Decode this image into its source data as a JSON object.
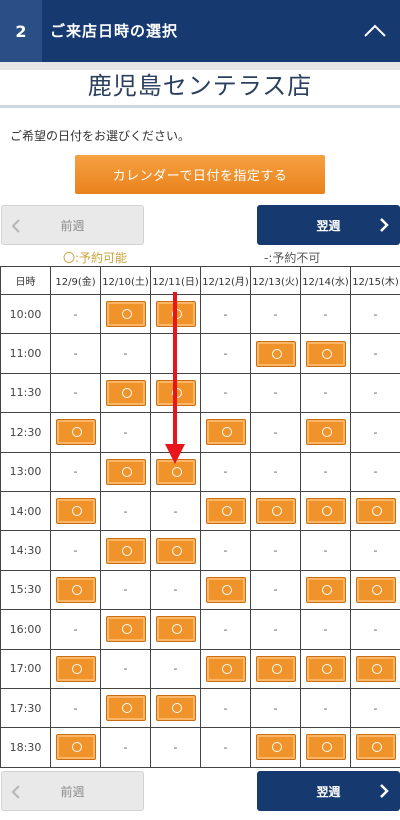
{
  "header": {
    "step_number": "2",
    "title": "ご来店日時の選択"
  },
  "store": {
    "name": "鹿児島センテラス店"
  },
  "instruction": "ご希望の日付をお選びください。",
  "calendar_button": "カレンダーで日付を指定する",
  "nav": {
    "prev_label": "前週",
    "next_label": "翌週"
  },
  "legend": {
    "available": "〇:予約可能",
    "unavailable": "-:予約不可"
  },
  "schedule": {
    "time_header": "日時",
    "dates": [
      {
        "label": "12/9(金)",
        "type": "weekday"
      },
      {
        "label": "12/10(土)",
        "type": "sat"
      },
      {
        "label": "12/11(日)",
        "type": "sun"
      },
      {
        "label": "12/12(月)",
        "type": "weekday"
      },
      {
        "label": "12/13(火)",
        "type": "weekday"
      },
      {
        "label": "12/14(水)",
        "type": "weekday"
      },
      {
        "label": "12/15(木)",
        "type": "weekday"
      }
    ],
    "unavailable_mark": "-",
    "rows": [
      {
        "time": "10:00",
        "slots": [
          0,
          1,
          1,
          0,
          0,
          0,
          0
        ]
      },
      {
        "time": "11:00",
        "slots": [
          0,
          0,
          0,
          0,
          1,
          1,
          0
        ]
      },
      {
        "time": "11:30",
        "slots": [
          0,
          1,
          1,
          0,
          0,
          0,
          0
        ]
      },
      {
        "time": "12:30",
        "slots": [
          1,
          0,
          0,
          1,
          0,
          1,
          0
        ]
      },
      {
        "time": "13:00",
        "slots": [
          0,
          1,
          1,
          0,
          0,
          0,
          0
        ]
      },
      {
        "time": "14:00",
        "slots": [
          1,
          0,
          0,
          1,
          1,
          1,
          1
        ]
      },
      {
        "time": "14:30",
        "slots": [
          0,
          1,
          1,
          0,
          0,
          0,
          0
        ]
      },
      {
        "time": "15:30",
        "slots": [
          1,
          0,
          0,
          1,
          0,
          1,
          1
        ]
      },
      {
        "time": "16:00",
        "slots": [
          0,
          1,
          1,
          0,
          0,
          0,
          0
        ]
      },
      {
        "time": "17:00",
        "slots": [
          1,
          0,
          0,
          1,
          1,
          1,
          1
        ]
      },
      {
        "time": "17:30",
        "slots": [
          0,
          1,
          1,
          0,
          0,
          0,
          0
        ]
      },
      {
        "time": "18:30",
        "slots": [
          1,
          0,
          0,
          0,
          1,
          1,
          1
        ]
      }
    ]
  },
  "colors": {
    "header_bg": "#163a70",
    "accent_orange": "#f0932b",
    "annotation_red": "#e8161b"
  }
}
